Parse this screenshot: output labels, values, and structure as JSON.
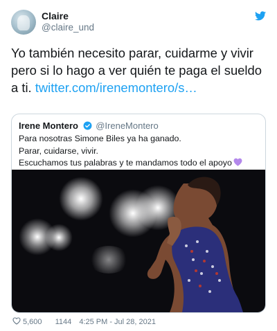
{
  "tweet": {
    "author_name": "Claire",
    "author_handle": "@claire_und",
    "text": "Yo también necesito parar, cuidarme y vivir pero si lo hago a ver quién te paga el sueldo a ti. ",
    "link_text": "twitter.com/irenemontero/s…",
    "likes": "5,600",
    "retweets": "1144",
    "timestamp": "4:25 PM - Jul 28, 2021"
  },
  "quoted": {
    "author_name": "Irene Montero",
    "author_handle": "@IreneMontero",
    "lines": [
      "Para nosotras Simone Biles ya ha ganado.",
      "Parar, cuidarse, vivir.",
      "Escuchamos tus palabras y te mandamos todo el apoyo"
    ]
  },
  "colors": {
    "link": "#1da1f2",
    "secondary_text": "#657786",
    "heart_emoji": "#b388eb",
    "border": "#ccd6dd"
  },
  "icons": [
    "twitter-bird-icon",
    "verified-badge-icon",
    "purple-heart-icon",
    "heart-outline-icon"
  ]
}
